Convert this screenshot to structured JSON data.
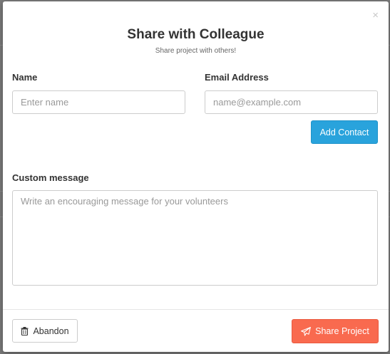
{
  "modal": {
    "close_glyph": "×",
    "title": "Share with Colleague",
    "subtitle": "Share project with others!"
  },
  "form": {
    "name_label": "Name",
    "name_placeholder": "Enter name",
    "email_label": "Email Address",
    "email_placeholder": "name@example.com",
    "add_contact_label": "Add Contact",
    "message_label": "Custom message",
    "message_placeholder": "Write an encouraging message for your volunteers"
  },
  "footer": {
    "abandon_label": "Abandon",
    "share_label": "Share Project"
  },
  "colors": {
    "primary": "#29a3dc",
    "danger": "#f96a4f"
  },
  "icons": {
    "abandon": "trash-icon",
    "share": "paper-plane-icon",
    "close": "close-icon"
  }
}
